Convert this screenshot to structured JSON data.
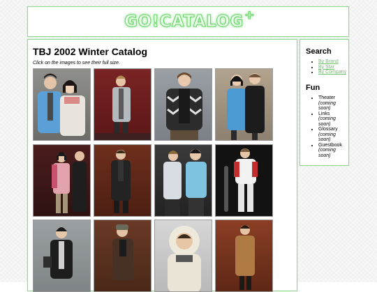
{
  "header": {
    "logo_text": "GO!CATALOG",
    "logo_plus": "+"
  },
  "main": {
    "title": "TBJ 2002 Winter Catalog",
    "intro": "Click on the images to see their full size."
  },
  "sidebar": {
    "search": {
      "heading": "Search",
      "links": [
        "By Brand",
        "By Star",
        "By Company"
      ]
    },
    "fun": {
      "heading": "Fun",
      "items": [
        {
          "label": "Theater",
          "note": "(coming soon)"
        },
        {
          "label": "Links",
          "note": "(coming soon)"
        },
        {
          "label": "Glossary",
          "note": "(coming soon)"
        },
        {
          "label": "Guestbook",
          "note": "(coming soon)"
        }
      ]
    }
  },
  "colors": {
    "border_green": "#8fd68f",
    "link_green": "#6fbf6f"
  }
}
